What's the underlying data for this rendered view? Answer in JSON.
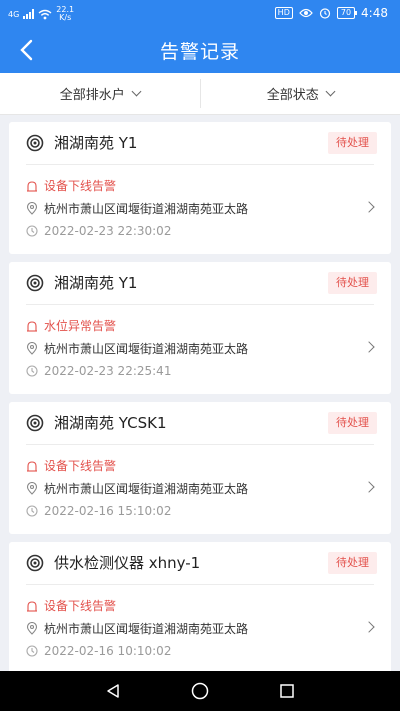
{
  "status_bar": {
    "network": "4G",
    "speed_value": "22.1",
    "speed_unit": "K/s",
    "hd": "HD",
    "battery": "70",
    "time": "4:48"
  },
  "header": {
    "title": "告警记录"
  },
  "filters": [
    {
      "label": "全部排水户"
    },
    {
      "label": "全部状态"
    }
  ],
  "records": [
    {
      "device": "湘湖南苑 Y1",
      "status": "待处理",
      "alarm_type": "设备下线告警",
      "address": "杭州市萧山区闻堰街道湘湖南苑亚太路",
      "time": "2022-02-23 22:30:02"
    },
    {
      "device": "湘湖南苑 Y1",
      "status": "待处理",
      "alarm_type": "水位异常告警",
      "address": "杭州市萧山区闻堰街道湘湖南苑亚太路",
      "time": "2022-02-23 22:25:41"
    },
    {
      "device": "湘湖南苑 YCSK1",
      "status": "待处理",
      "alarm_type": "设备下线告警",
      "address": "杭州市萧山区闻堰街道湘湖南苑亚太路",
      "time": "2022-02-16 15:10:02"
    },
    {
      "device": "供水检测仪器 xhny-1",
      "status": "待处理",
      "alarm_type": "设备下线告警",
      "address": "杭州市萧山区闻堰街道湘湖南苑亚太路",
      "time": "2022-02-16 10:10:02"
    }
  ],
  "colors": {
    "header_bg": "#2f86f0",
    "alarm_red": "#e3524c",
    "badge_bg": "#fdecec"
  }
}
